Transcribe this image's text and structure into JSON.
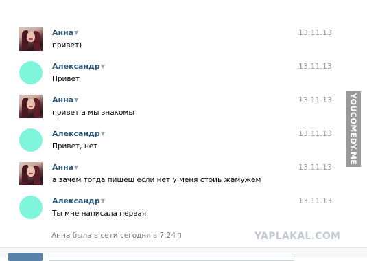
{
  "messages": [
    {
      "author": "Анна",
      "date": "13.11.13",
      "text": "привет)",
      "avatar": "photo"
    },
    {
      "author": "Александр",
      "date": "13.11.13",
      "text": "Привет",
      "avatar": "blob"
    },
    {
      "author": "Анна",
      "date": "13.11.13",
      "text": "привет а мы знакомы",
      "avatar": "photo"
    },
    {
      "author": "Александр",
      "date": "13.11.13",
      "text": "Привет, нет",
      "avatar": "blob"
    },
    {
      "author": "Анна",
      "date": "13.11.13",
      "text": "а зачем тогда пишеш если нет у меня стоиь жамужем",
      "avatar": "photo"
    },
    {
      "author": "Александр",
      "date": "13.11.13",
      "text": "Ты мне написала первая",
      "avatar": "blob"
    }
  ],
  "status": {
    "text": "Анна была в сети сегодня в 7:24",
    "icon": "mobile-phone-icon"
  },
  "watermarks": {
    "side": "YOUCOMEDY.ME",
    "bottom": "YAPLAKAL.COM"
  },
  "colors": {
    "author": "#2b587a",
    "date": "#999999",
    "blob_avatar": "#7ff5dc",
    "button": "#5b82a9"
  }
}
